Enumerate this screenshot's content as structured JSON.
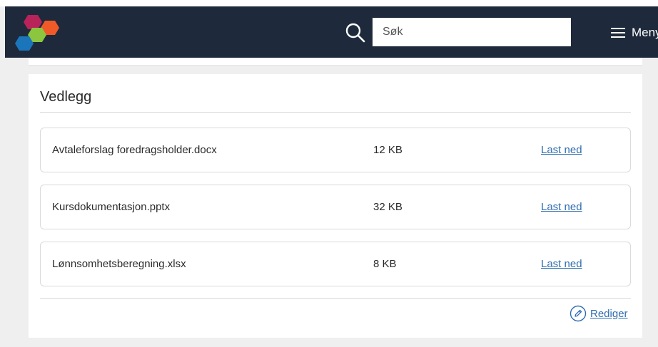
{
  "header": {
    "logo_icon": "hexagon-cluster-logo",
    "search": {
      "icon": "search-icon",
      "placeholder": "Søk",
      "value": ""
    },
    "menu": {
      "icon": "hamburger-icon",
      "label": "Meny"
    }
  },
  "attachments": {
    "title": "Vedlegg",
    "files": [
      {
        "name": "Avtaleforslag foredragsholder.docx",
        "size": "12 KB",
        "action": "Last ned"
      },
      {
        "name": "Kursdokumentasjon.pptx",
        "size": "32 KB",
        "action": "Last ned"
      },
      {
        "name": "Lønnsomhetsberegning.xlsx",
        "size": "8 KB",
        "action": "Last ned"
      }
    ],
    "edit": {
      "icon": "pencil-icon",
      "label": "Rediger"
    }
  },
  "colors": {
    "header_bg": "#1e2a3b",
    "page_bg": "#efefef",
    "link": "#2f6db0",
    "logo": [
      "#b8235a",
      "#f05a28",
      "#8cc63f",
      "#1b75bb"
    ]
  }
}
